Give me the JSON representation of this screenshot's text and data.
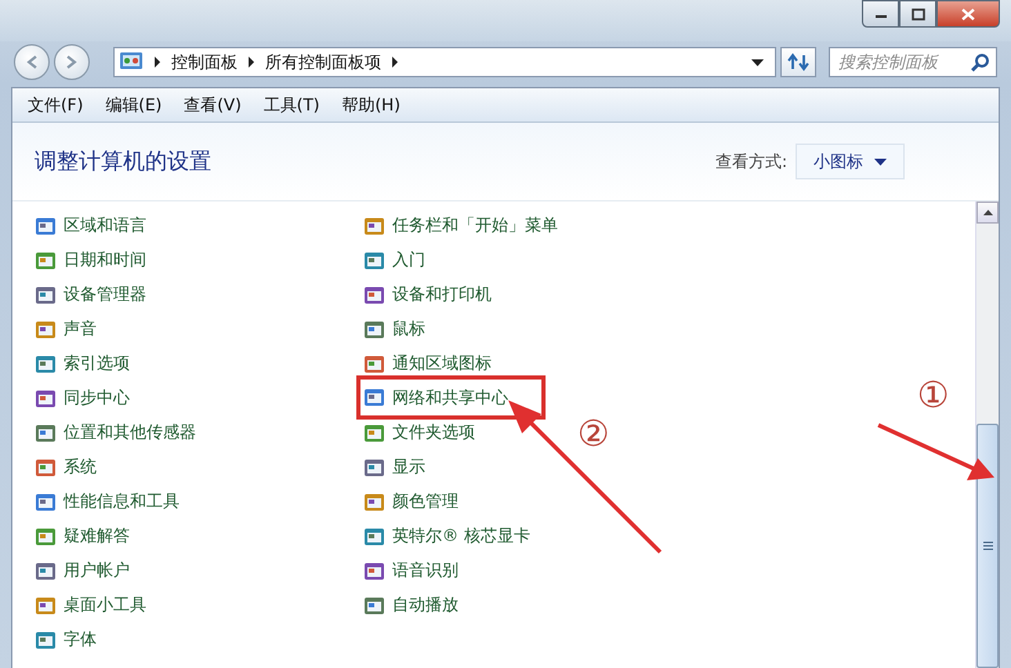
{
  "address_bar": {
    "breadcrumbs": [
      "控制面板",
      "所有控制面板项"
    ]
  },
  "search": {
    "placeholder": "搜索控制面板"
  },
  "menu": [
    "文件(F)",
    "编辑(E)",
    "查看(V)",
    "工具(T)",
    "帮助(H)"
  ],
  "header": {
    "title": "调整计算机的设置",
    "view_label": "查看方式:",
    "view_value": "小图标"
  },
  "left_column": [
    {
      "label": "区域和语言",
      "highlighted": false
    },
    {
      "label": "日期和时间",
      "highlighted": false
    },
    {
      "label": "设备管理器",
      "highlighted": false
    },
    {
      "label": "声音",
      "highlighted": false
    },
    {
      "label": "索引选项",
      "highlighted": false
    },
    {
      "label": "同步中心",
      "highlighted": false
    },
    {
      "label": "位置和其他传感器",
      "highlighted": false
    },
    {
      "label": "系统",
      "highlighted": false
    },
    {
      "label": "性能信息和工具",
      "highlighted": false
    },
    {
      "label": "疑难解答",
      "highlighted": false
    },
    {
      "label": "用户帐户",
      "highlighted": false
    },
    {
      "label": "桌面小工具",
      "highlighted": false
    },
    {
      "label": "字体",
      "highlighted": false
    }
  ],
  "right_column": [
    {
      "label": "任务栏和「开始」菜单",
      "highlighted": false
    },
    {
      "label": "入门",
      "highlighted": false
    },
    {
      "label": "设备和打印机",
      "highlighted": false
    },
    {
      "label": "鼠标",
      "highlighted": false
    },
    {
      "label": "通知区域图标",
      "highlighted": false
    },
    {
      "label": "网络和共享中心",
      "highlighted": true
    },
    {
      "label": "文件夹选项",
      "highlighted": false
    },
    {
      "label": "显示",
      "highlighted": false
    },
    {
      "label": "颜色管理",
      "highlighted": false
    },
    {
      "label": "英特尔® 核芯显卡",
      "highlighted": false
    },
    {
      "label": "语音识别",
      "highlighted": false
    },
    {
      "label": "自动播放",
      "highlighted": false
    }
  ],
  "annotations": [
    "①",
    "②"
  ]
}
